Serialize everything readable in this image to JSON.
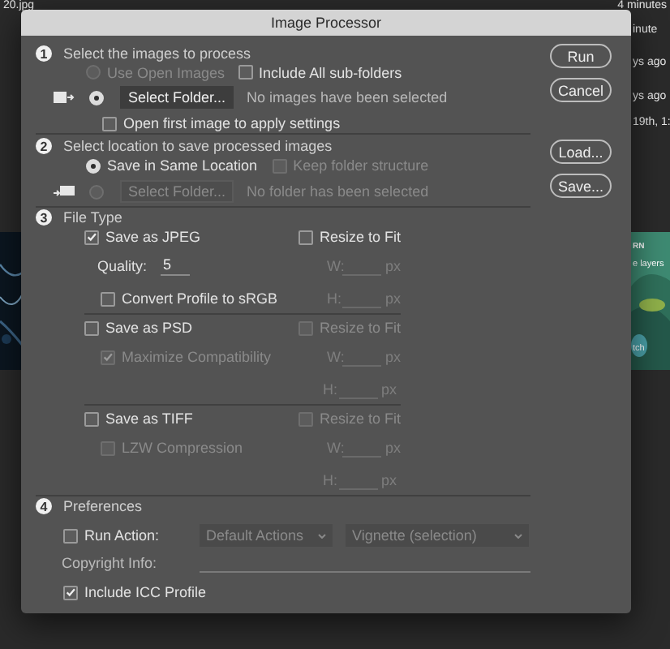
{
  "background": {
    "file_name": "20.jpg",
    "time_top": "4 minutes",
    "side_texts": [
      "inute",
      "ys ago",
      "ys ago",
      "19th, 1:"
    ],
    "right_card": {
      "kind": "picture",
      "texts": [
        "RN",
        "e layers",
        "tch"
      ]
    }
  },
  "dialog": {
    "title": "Image Processor",
    "buttons": [
      {
        "label": "Run"
      },
      {
        "label": "Cancel"
      },
      {
        "label": "Load..."
      },
      {
        "label": "Save..."
      }
    ],
    "sections": [
      {
        "kind": "source",
        "number": "1",
        "title": "Select the images to process",
        "use_open": {
          "label": "Use Open Images",
          "selected": false,
          "disabled": true
        },
        "include_subfolders": {
          "label": "Include All sub-folders",
          "checked": false
        },
        "folder": {
          "selected": true,
          "button": "Select Folder...",
          "status": "No images have been selected"
        },
        "open_first": {
          "label": "Open first image to apply settings",
          "checked": false
        }
      },
      {
        "kind": "destination",
        "number": "2",
        "title": "Select location to save processed images",
        "same_location": {
          "label": "Save in Same Location",
          "selected": true
        },
        "keep_structure": {
          "label": "Keep folder structure",
          "checked": false,
          "disabled": true
        },
        "folder": {
          "selected": false,
          "button": "Select Folder...",
          "disabled": true,
          "status": "No folder has been selected"
        }
      },
      {
        "kind": "file_type",
        "number": "3",
        "title": "File Type",
        "types": [
          {
            "label": "Save as JPEG",
            "checked": true,
            "options": [
              {
                "kind": "quality",
                "label": "Quality:",
                "value": "5"
              },
              {
                "kind": "checkbox",
                "label": "Convert Profile to sRGB",
                "checked": false,
                "disabled": false
              }
            ],
            "resize": {
              "label": "Resize to Fit",
              "checked": false,
              "disabled": false
            },
            "width": {
              "label": "W:",
              "unit": "px"
            },
            "height": {
              "label": "H:",
              "unit": "px"
            }
          },
          {
            "label": "Save as PSD",
            "checked": false,
            "options": [
              {
                "kind": "checkbox",
                "label": "Maximize Compatibility",
                "checked": true,
                "disabled": true
              }
            ],
            "resize": {
              "label": "Resize to Fit",
              "checked": false,
              "disabled": true
            },
            "width": {
              "label": "W:",
              "unit": "px"
            },
            "height": {
              "label": "H:",
              "unit": "px"
            }
          },
          {
            "label": "Save as TIFF",
            "checked": false,
            "options": [
              {
                "kind": "checkbox",
                "label": "LZW Compression",
                "checked": false,
                "disabled": true
              }
            ],
            "resize": {
              "label": "Resize to Fit",
              "checked": false,
              "disabled": true
            },
            "width": {
              "label": "W:",
              "unit": "px"
            },
            "height": {
              "label": "H:",
              "unit": "px"
            }
          }
        ]
      },
      {
        "kind": "preferences",
        "number": "4",
        "title": "Preferences",
        "run_action": {
          "label": "Run Action:",
          "checked": false,
          "set": "Default Actions",
          "action": "Vignette (selection)"
        },
        "copyright": {
          "label": "Copyright Info:"
        },
        "icc": {
          "label": "Include ICC Profile",
          "checked": true
        }
      }
    ]
  }
}
